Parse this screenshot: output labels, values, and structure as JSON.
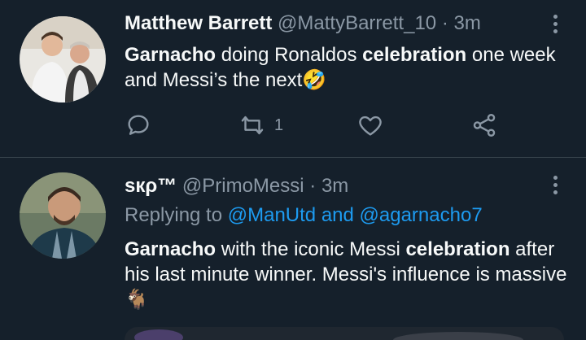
{
  "tweets": [
    {
      "display_name": "Matthew Barrett",
      "handle": "@MattyBarrett_10",
      "time": "· 3m",
      "text_parts": {
        "p1_bold": "Garnacho",
        "p2": " doing Ronaldos ",
        "p3_bold": "celebration",
        "p4": " one week and Messi’s the next",
        "emoji": "🤣"
      },
      "actions": {
        "reply_icon": "reply-icon",
        "retweet_icon": "retweet-icon",
        "retweet_count": "1",
        "like_icon": "heart-icon",
        "share_icon": "share-icon"
      }
    },
    {
      "display_name": "ѕкρ™",
      "handle": "@PrimoMessi",
      "time": "· 3m",
      "replying_to_label": "Replying to",
      "replying_to_users": "@ManUtd and @agarnacho7",
      "text_parts": {
        "p1_bold": "Garnacho",
        "p2": " with the iconic Messi ",
        "p3_bold": "celebration",
        "p4": " after his last minute winner. Messi's influence is massive",
        "emoji": "🐐"
      }
    }
  ],
  "colors": {
    "background": "#15202b",
    "text": "#f7f9f9",
    "muted": "#8b98a5",
    "link": "#1d9bf0",
    "divider": "#38444d"
  }
}
